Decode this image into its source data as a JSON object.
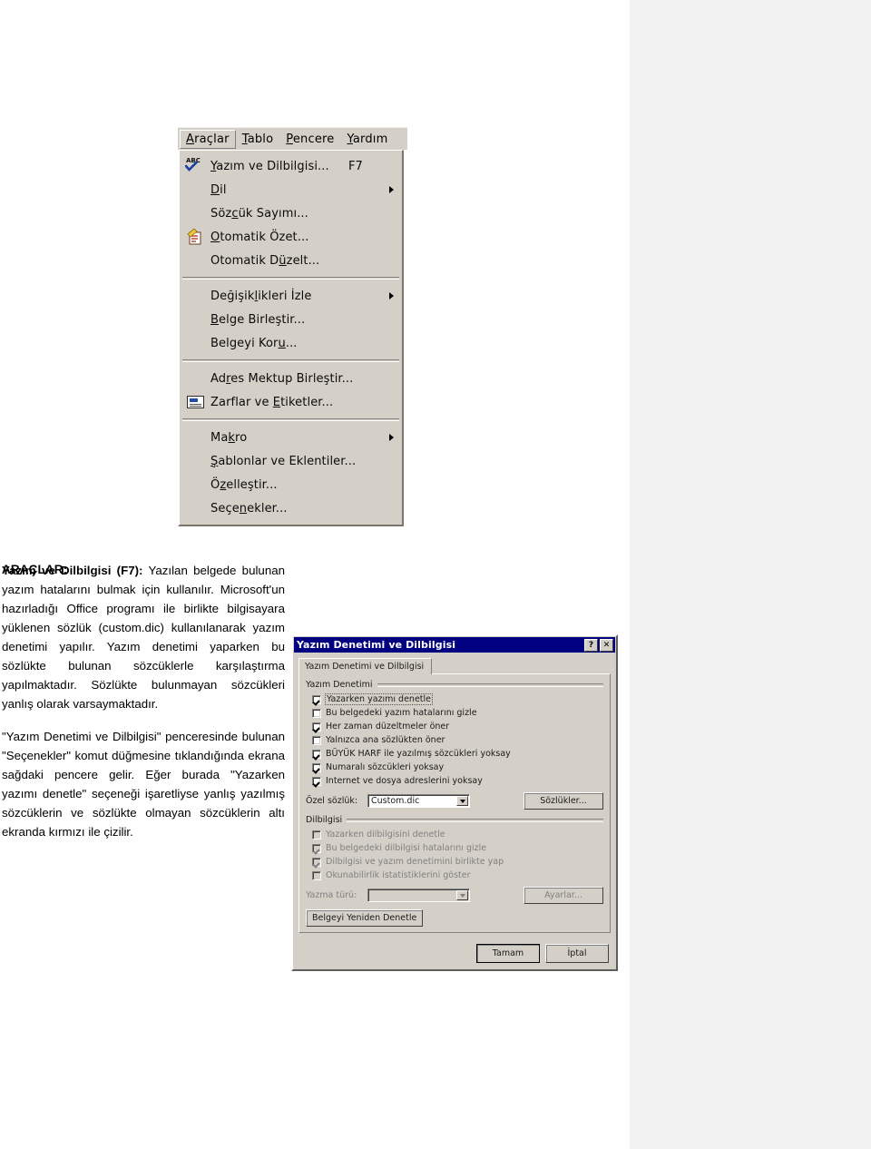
{
  "menu": {
    "menubar": [
      {
        "label": "Araçlar",
        "accel": "A",
        "active": true
      },
      {
        "label": "Tablo",
        "accel": "T",
        "active": false
      },
      {
        "label": "Pencere",
        "accel": "P",
        "active": false
      },
      {
        "label": "Yardım",
        "accel": "Y",
        "active": false
      }
    ],
    "items": [
      {
        "label": "Yazım ve Dilbilgisi...",
        "accel_char": "Y",
        "shortcut": "F7",
        "icon": "spelling-abc-check-icon",
        "submenu": false
      },
      {
        "label": "Dil",
        "accel_char": "D",
        "shortcut": "",
        "icon": "",
        "submenu": true
      },
      {
        "label": "Sözcük Sayımı...",
        "accel_char": "c",
        "shortcut": "",
        "icon": "",
        "submenu": false
      },
      {
        "label": "Otomatik Özet...",
        "accel_char": "O",
        "shortcut": "",
        "icon": "autosummarize-icon",
        "submenu": false
      },
      {
        "label": "Otomatik Düzelt...",
        "accel_char": "ü",
        "shortcut": "",
        "icon": "",
        "submenu": false
      },
      {
        "separator": true
      },
      {
        "label": "Değişiklikleri İzle",
        "accel_char": "l",
        "shortcut": "",
        "icon": "",
        "submenu": true
      },
      {
        "label": "Belge Birleştir...",
        "accel_char": "B",
        "shortcut": "",
        "icon": "",
        "submenu": false
      },
      {
        "label": "Belgeyi Koru...",
        "accel_char": "u",
        "shortcut": "",
        "icon": "",
        "submenu": false
      },
      {
        "separator": true
      },
      {
        "label": "Adres Mektup Birleştir...",
        "accel_char": "r",
        "shortcut": "",
        "icon": "",
        "submenu": false
      },
      {
        "label": "Zarflar ve Etiketler...",
        "accel_char": "E",
        "shortcut": "",
        "icon": "envelope-label-icon",
        "submenu": false
      },
      {
        "separator": true
      },
      {
        "label": "Makro",
        "accel_char": "k",
        "shortcut": "",
        "icon": "",
        "submenu": true
      },
      {
        "label": "Şablonlar ve Eklentiler...",
        "accel_char": "Ş",
        "shortcut": "",
        "icon": "",
        "submenu": false
      },
      {
        "label": "Özelleştir...",
        "accel_char": "z",
        "shortcut": "",
        "icon": "",
        "submenu": false
      },
      {
        "label": "Seçenekler...",
        "accel_char": "n",
        "shortcut": "",
        "icon": "",
        "submenu": false
      }
    ]
  },
  "document": {
    "heading": "ARAÇLAR:",
    "paragraphs": [
      {
        "bold_lead": "Yazım ve Dilbilgisi (F7):",
        "text": " Yazılan belgede bulunan yazım hatalarını bulmak için kullanılır. Microsoft'un hazırladığı Office programı ile birlikte bilgisayara yüklenen sözlük (custom.dic) kullanılanarak yazım denetimi yapılır. Yazım denetimi yaparken bu sözlükte bulunan sözcüklerle karşılaştırma yapılmaktadır. Sözlükte bulunmayan sözcükleri yanlış olarak varsaymaktadır."
      },
      {
        "bold_lead": "",
        "text": "\"Yazım Denetimi ve Dilbilgisi\" penceresinde bulunan \"Seçenekler\" komut düğmesine tıklandığında ekrana sağdaki pencere gelir. Eğer burada \"Yazarken yazımı denetle\" seçeneği işaretliyse yanlış yazılmış sözcüklerin ve sözlükte olmayan sözcüklerin altı ekranda kırmızı ile çizilir."
      }
    ]
  },
  "dialog": {
    "title": "Yazım Denetimi ve Dilbilgisi",
    "help_button": "?",
    "close_button": "✕",
    "tab_label": "Yazım Denetimi ve Dilbilgisi",
    "spelling_group": {
      "title": "Yazım Denetimi",
      "checkboxes": [
        {
          "label": "Yazarken yazımı denetle",
          "checked": true,
          "disabled": false,
          "focused": true
        },
        {
          "label": "Bu belgedeki yazım hatalarını gizle",
          "checked": false,
          "disabled": false,
          "focused": false
        },
        {
          "label": "Her zaman düzeltmeler öner",
          "checked": true,
          "disabled": false,
          "focused": false
        },
        {
          "label": "Yalnızca ana sözlükten öner",
          "checked": false,
          "disabled": false,
          "focused": false
        },
        {
          "label": "BÜYÜK HARF ile yazılmış sözcükleri yoksay",
          "checked": true,
          "disabled": false,
          "focused": false
        },
        {
          "label": "Numaralı sözcükleri yoksay",
          "checked": true,
          "disabled": false,
          "focused": false
        },
        {
          "label": "Internet ve dosya adreslerini yoksay",
          "checked": true,
          "disabled": false,
          "focused": false
        }
      ],
      "field_label": "Özel sözlük:",
      "field_value": "Custom.dic",
      "button": "Sözlükler..."
    },
    "grammar_group": {
      "title": "Dilbilgisi",
      "checkboxes": [
        {
          "label": "Yazarken dilbilgisini denetle",
          "checked": false,
          "disabled": true
        },
        {
          "label": "Bu belgedeki dilbilgisi hatalarını gizle",
          "checked": true,
          "disabled": true
        },
        {
          "label": "Dilbilgisi ve yazım denetimini birlikte yap",
          "checked": true,
          "disabled": true
        },
        {
          "label": "Okunabilirlik istatistiklerini göster",
          "checked": false,
          "disabled": true
        }
      ],
      "field_label": "Yazma türü:",
      "field_value": "",
      "button": "Ayarlar..."
    },
    "recheck_button": "Belgeyi Yeniden Denetle",
    "ok_button": "Tamam",
    "cancel_button": "İptal"
  },
  "colors": {
    "titlebar": "#000080",
    "dialog_face": "#d4d0c8",
    "menu_face": "#d4d0c8",
    "right_panel": "#f2f2f2",
    "page": "#ffffff"
  }
}
